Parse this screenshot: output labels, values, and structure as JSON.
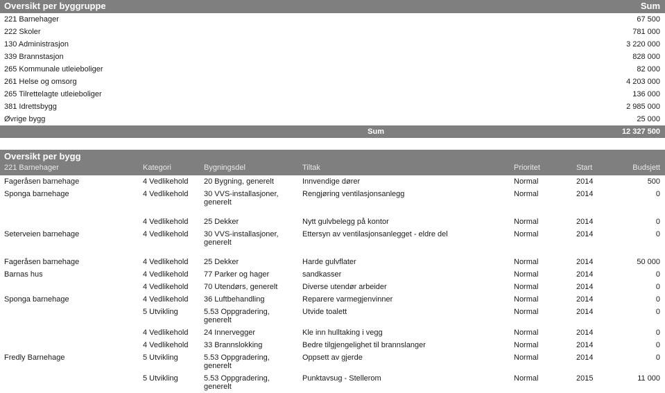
{
  "colors": {
    "band": "#7f7f7f",
    "band_text": "#ffffff",
    "body_text": "#1a1a1a",
    "page_background": "#ffffff"
  },
  "table_group": {
    "title": "Oversikt per byggruppe",
    "sum_column_header": "Sum",
    "rows": [
      {
        "name": "221 Barnehager",
        "sum": "67 500"
      },
      {
        "name": "222 Skoler",
        "sum": "781 000"
      },
      {
        "name": "130 Administrasjon",
        "sum": "3 220 000"
      },
      {
        "name": "339 Brannstasjon",
        "sum": "828 000"
      },
      {
        "name": "265 Kommunale utleieboliger",
        "sum": "82 000"
      },
      {
        "name": "261 Helse og omsorg",
        "sum": "4 203 000"
      },
      {
        "name": "265 Tilrettelagte utleieboliger",
        "sum": "136 000"
      },
      {
        "name": "381 Idrettsbygg",
        "sum": "2 985 000"
      },
      {
        "name": "Øvrige bygg",
        "sum": "25 000"
      }
    ],
    "footer": {
      "label": "Sum",
      "value": "12 327 500"
    }
  },
  "table_building": {
    "title": "Oversikt per bygg",
    "headers": {
      "bygg": "221 Barnehager",
      "kategori": "Kategori",
      "bygningsdel": "Bygningsdel",
      "tiltak": "Tiltak",
      "prioritet": "Prioritet",
      "start": "Start",
      "budsjett": "Budsjett"
    },
    "rows": [
      {
        "bygg": "Fageråsen barnehage",
        "kategori": "4 Vedlikehold",
        "bygningsdel": "20 Bygning, generelt",
        "tiltak": "Innvendige dører",
        "prioritet": "Normal",
        "start": "2014",
        "budsjett": "500",
        "tall": false
      },
      {
        "bygg": "Sponga barnehage",
        "kategori": "4 Vedlikehold",
        "bygningsdel": "30 VVS-installasjoner, generelt",
        "tiltak": "Rengjøring ventilasjonsanlegg",
        "prioritet": "Normal",
        "start": "2014",
        "budsjett": "0",
        "tall": true
      },
      {
        "bygg": "",
        "kategori": "4 Vedlikehold",
        "bygningsdel": "25 Dekker",
        "tiltak": "Nytt gulvbelegg på kontor",
        "prioritet": "Normal",
        "start": "2014",
        "budsjett": "0",
        "tall": false
      },
      {
        "bygg": "Seterveien barnehage",
        "kategori": "4 Vedlikehold",
        "bygningsdel": "30 VVS-installasjoner, generelt",
        "tiltak": "Ettersyn av ventilasjonsanlegget - eldre del",
        "prioritet": "Normal",
        "start": "2014",
        "budsjett": "0",
        "tall": true
      },
      {
        "bygg": "Fageråsen barnehage",
        "kategori": "4 Vedlikehold",
        "bygningsdel": "25 Dekker",
        "tiltak": "Harde gulvflater",
        "prioritet": "Normal",
        "start": "2014",
        "budsjett": "50 000",
        "tall": false
      },
      {
        "bygg": "Barnas hus",
        "kategori": "4 Vedlikehold",
        "bygningsdel": "77 Parker og hager",
        "tiltak": "sandkasser",
        "prioritet": "Normal",
        "start": "2014",
        "budsjett": "0",
        "tall": false
      },
      {
        "bygg": "",
        "kategori": "4 Vedlikehold",
        "bygningsdel": "70 Utendørs, generelt",
        "tiltak": "Diverse utendør arbeider",
        "prioritet": "Normal",
        "start": "2014",
        "budsjett": "0",
        "tall": false
      },
      {
        "bygg": "Sponga barnehage",
        "kategori": "4 Vedlikehold",
        "bygningsdel": "36 Luftbehandling",
        "tiltak": "Reparere varmegjenvinner",
        "prioritet": "Normal",
        "start": "2014",
        "budsjett": "0",
        "tall": false
      },
      {
        "bygg": "",
        "kategori": "5 Utvikling",
        "bygningsdel": "5.53 Oppgradering, generelt",
        "tiltak": "Utvide toalett",
        "prioritet": "Normal",
        "start": "2014",
        "budsjett": "0",
        "tall": false
      },
      {
        "bygg": "",
        "kategori": "4 Vedlikehold",
        "bygningsdel": "24 Innervegger",
        "tiltak": "Kle inn hulltaking i vegg",
        "prioritet": "Normal",
        "start": "2014",
        "budsjett": "0",
        "tall": false
      },
      {
        "bygg": "",
        "kategori": "4 Vedlikehold",
        "bygningsdel": "33 Brannslokking",
        "tiltak": "Bedre tilgjengelighet til brannslanger",
        "prioritet": "Normal",
        "start": "2014",
        "budsjett": "0",
        "tall": false
      },
      {
        "bygg": "Fredly Barnehage",
        "kategori": "5 Utvikling",
        "bygningsdel": "5.53 Oppgradering, generelt",
        "tiltak": "Oppsett av gjerde",
        "prioritet": "Normal",
        "start": "2014",
        "budsjett": "0",
        "tall": false
      },
      {
        "bygg": "",
        "kategori": "5 Utvikling",
        "bygningsdel": "5.53 Oppgradering, generelt",
        "tiltak": "Punktavsug - Stellerom",
        "prioritet": "Normal",
        "start": "2015",
        "budsjett": "11 000",
        "tall": false
      }
    ]
  }
}
